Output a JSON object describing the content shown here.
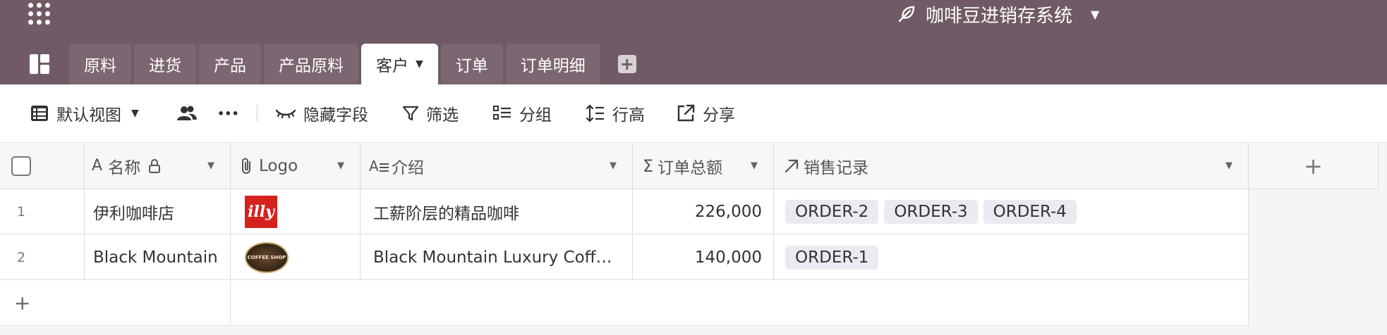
{
  "app": {
    "title": "咖啡豆进销存系统"
  },
  "tabs": [
    {
      "label": "原料"
    },
    {
      "label": "进货"
    },
    {
      "label": "产品"
    },
    {
      "label": "产品原料"
    },
    {
      "label": "客户"
    },
    {
      "label": "订单"
    },
    {
      "label": "订单明细"
    }
  ],
  "toolbar": {
    "view_label": "默认视图",
    "more_label": "•••",
    "hide_fields": "隐藏字段",
    "filter": "筛选",
    "group": "分组",
    "row_height": "行高",
    "share": "分享"
  },
  "columns": {
    "name": "名称",
    "logo": "Logo",
    "intro": "介绍",
    "total": "订单总额",
    "sales": "销售记录"
  },
  "rows": [
    {
      "num": "1",
      "name": "伊利咖啡店",
      "logo_text": "illy",
      "intro": "工薪阶层的精品咖啡",
      "total": "226,000",
      "sales": [
        "ORDER-2",
        "ORDER-3",
        "ORDER-4"
      ]
    },
    {
      "num": "2",
      "name": "Black Mountain",
      "logo_text": "COFFEE SHOP",
      "intro": "Black Mountain Luxury Coff…",
      "total": "140,000",
      "sales": [
        "ORDER-1"
      ]
    }
  ],
  "add_row": "+",
  "add_column": "+",
  "colors": {
    "header_bg": "#705a65",
    "tag_bg": "#e9ebf1",
    "illy_red": "#d4231e"
  }
}
